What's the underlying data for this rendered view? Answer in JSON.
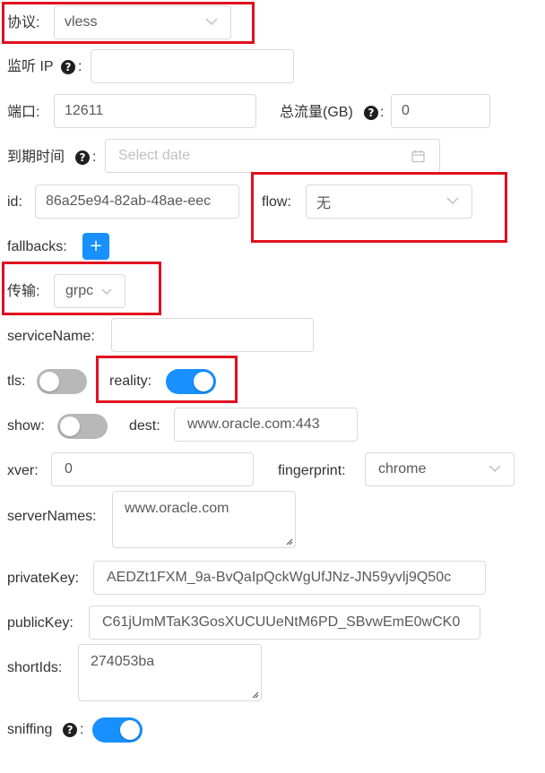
{
  "form": {
    "protocol": {
      "label": "协议:",
      "value": "vless"
    },
    "listen_ip": {
      "label": "监听 IP",
      "colon": ":",
      "value": ""
    },
    "port": {
      "label": "端口:",
      "value": "12611"
    },
    "total_traffic": {
      "label": "总流量(GB)",
      "colon": ":",
      "value": "0"
    },
    "expiry_time": {
      "label": "到期时间",
      "colon": ":",
      "placeholder": "Select date"
    },
    "id": {
      "label": "id:",
      "value": "86a25e94-82ab-48ae-eec"
    },
    "flow": {
      "label": "flow:",
      "value": "无"
    },
    "fallbacks": {
      "label": "fallbacks:",
      "add_button": "+"
    },
    "transport": {
      "label": "传输:",
      "value": "grpc"
    },
    "service_name": {
      "label": "serviceName:",
      "value": ""
    },
    "tls": {
      "label": "tls:",
      "enabled": false
    },
    "reality": {
      "label": "reality:",
      "enabled": true
    },
    "show": {
      "label": "show:",
      "enabled": false
    },
    "dest": {
      "label": "dest:",
      "value": "www.oracle.com:443"
    },
    "xver": {
      "label": "xver:",
      "value": "0"
    },
    "fingerprint": {
      "label": "fingerprint:",
      "value": "chrome"
    },
    "server_names": {
      "label": "serverNames:",
      "value": "www.oracle.com"
    },
    "private_key": {
      "label": "privateKey:",
      "value": "AEDZt1FXM_9a-BvQaIpQckWgUfJNz-JN59yvlj9Q50c"
    },
    "public_key": {
      "label": "publicKey:",
      "value": "C61jUmMTaK3GosXUCUUeNtM6PD_SBvwEmE0wCK0"
    },
    "short_ids": {
      "label": "shortIds:",
      "value": "274053ba"
    },
    "sniffing": {
      "label": "sniffing",
      "colon": ":",
      "enabled": true
    },
    "help_icon_glyph": "?"
  },
  "colors": {
    "highlight_box": "#e0101e",
    "switch_on": "#1890ff",
    "switch_off": "#b8b8b8",
    "primary_button": "#1890ff"
  }
}
